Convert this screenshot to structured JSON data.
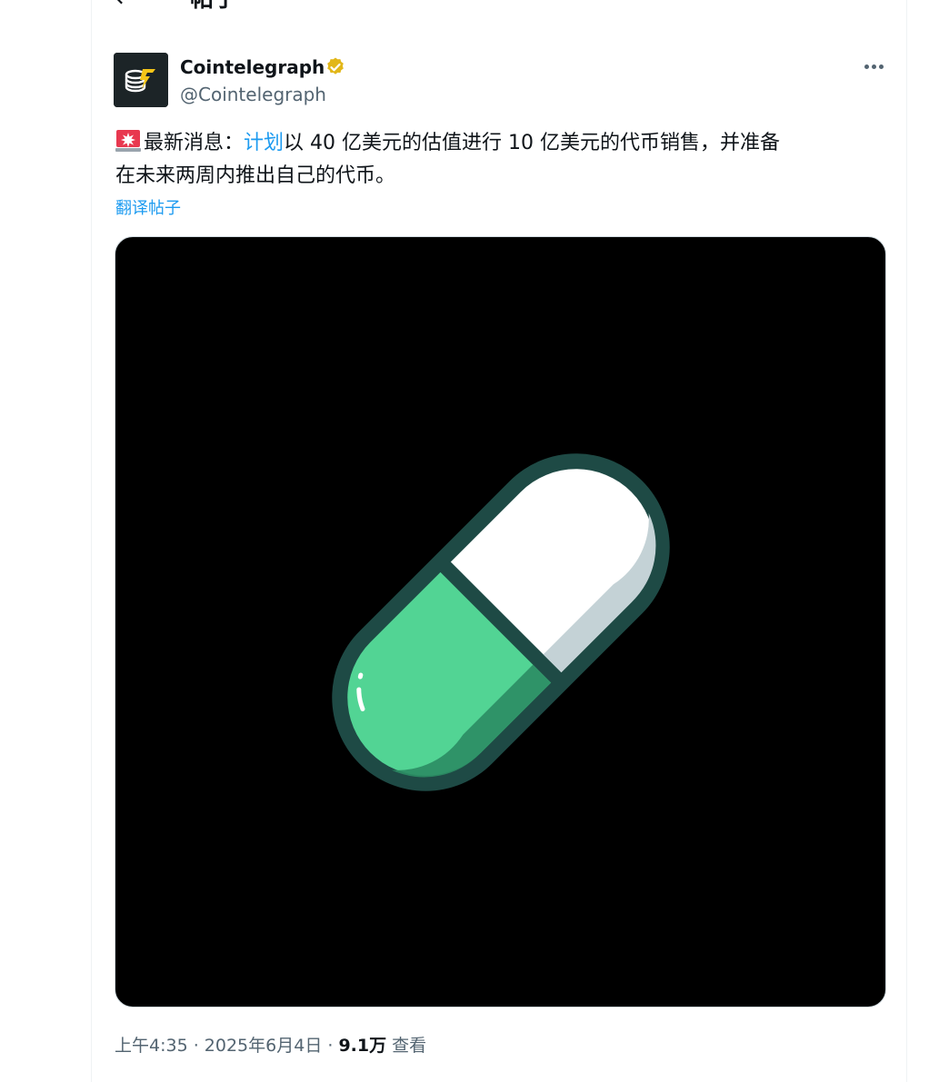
{
  "header": {
    "back_glyph": "←",
    "title": "帖子"
  },
  "author": {
    "display_name": "Cointelegraph",
    "handle": "@Cointelegraph",
    "verified_color": "#e2b719"
  },
  "tweet": {
    "line1_prefix": "最新消息：",
    "line1_link": "计划",
    "line1_suffix": "以 40 亿美元的估值进行 10 亿美元的代币销售，并准备",
    "line2": "在未来两周内推出自己的代币。",
    "translate_label": "翻译帖子"
  },
  "meta": {
    "time": "上午4:35",
    "separator1": " · ",
    "date": "2025年6月4日",
    "separator2": " · ",
    "views_count": "9.1万",
    "views_label": " 查看"
  },
  "colors": {
    "link": "#1d9bf0",
    "secondary_text": "#536471",
    "pill_green": "#52d494",
    "pill_outline": "#1e4a45"
  },
  "icons": {
    "back": "arrow-left-icon",
    "badge": "verified-badge-icon",
    "more": "more-dots-icon",
    "siren": "police-light-emoji-icon"
  }
}
